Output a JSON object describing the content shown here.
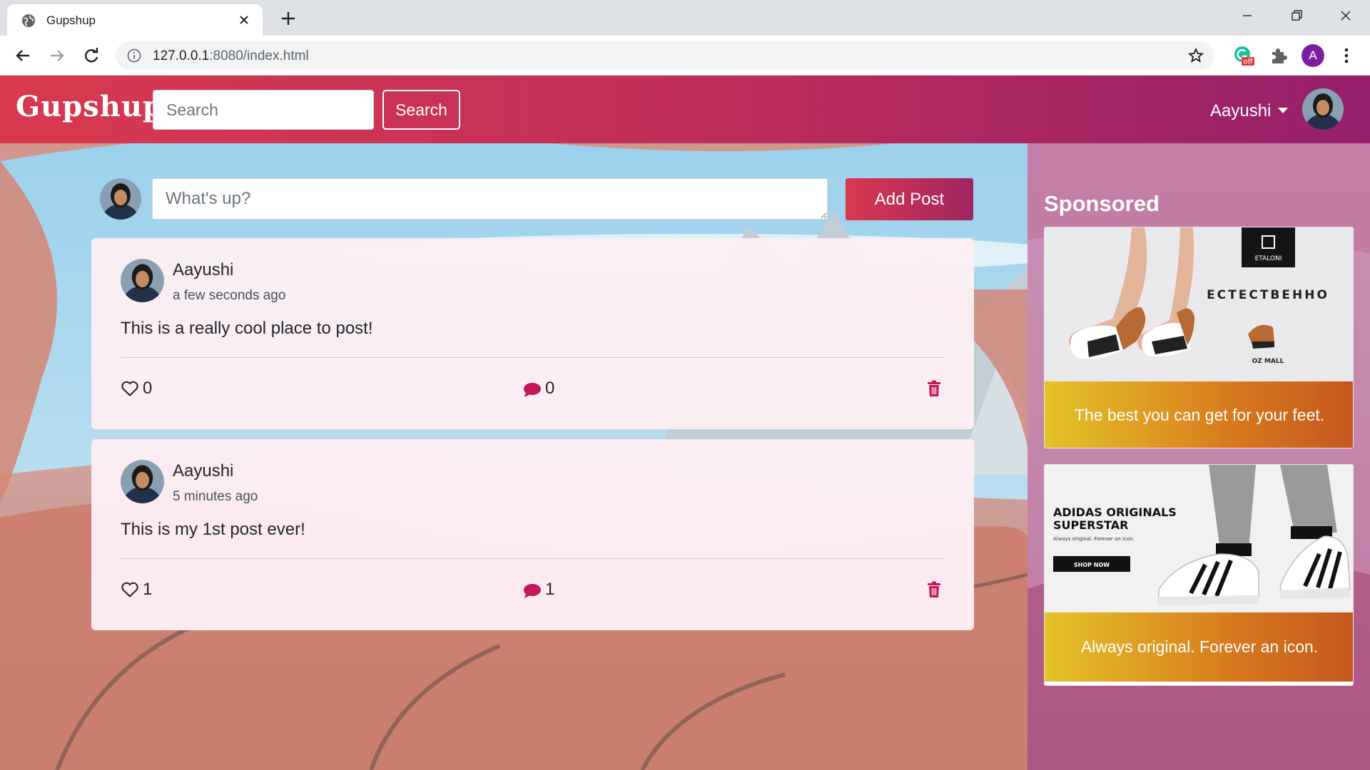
{
  "browser": {
    "tab_title": "Gupshup",
    "url_host": "127.0.0.1",
    "url_rest": ":8080/index.html",
    "extension_badge": "off",
    "profile_initial": "A"
  },
  "navbar": {
    "brand": "Gupshup",
    "search_placeholder": "Search",
    "search_button": "Search",
    "user_name": "Aayushi"
  },
  "composer": {
    "placeholder": "What's up?",
    "add_button": "Add Post"
  },
  "posts": [
    {
      "author": "Aayushi",
      "time": "a few seconds ago",
      "text": "This is a really cool place to post!",
      "likes": "0",
      "comments": "0"
    },
    {
      "author": "Aayushi",
      "time": "5 minutes ago",
      "text": "This is my 1st post ever!",
      "likes": "1",
      "comments": "1"
    }
  ],
  "sidebar": {
    "title": "Sponsored",
    "ads": [
      {
        "caption": "The best you can get for your feet.",
        "brand": "ETALONI",
        "headline": "ЕСТЕСТВЕННО",
        "mall": "OZ MALL"
      },
      {
        "caption": "Always original. Forever an icon.",
        "brand": "ADIDAS ORIGINALS SUPERSTAR",
        "tagline": "Always original. Forever an icon.",
        "cta": "SHOP NOW"
      }
    ]
  },
  "colors": {
    "accent": "#d9394f",
    "accent_dark": "#951f6b",
    "icon_pink": "#c2185b"
  }
}
